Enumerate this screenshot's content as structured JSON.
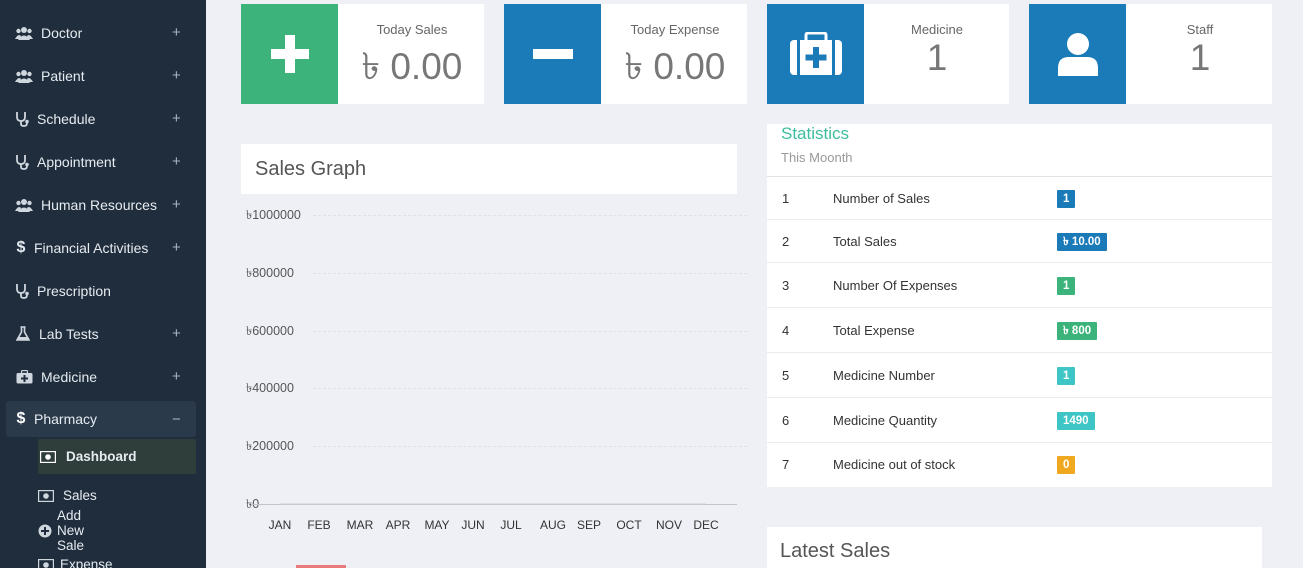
{
  "sidebar": {
    "items": [
      {
        "label": "Doctor",
        "icon": "users-icon",
        "expand": "+"
      },
      {
        "label": "Patient",
        "icon": "users-icon",
        "expand": "+"
      },
      {
        "label": "Schedule",
        "icon": "stethoscope-icon",
        "expand": "+"
      },
      {
        "label": "Appointment",
        "icon": "stethoscope-icon",
        "expand": "+"
      },
      {
        "label": "Human Resources",
        "icon": "users-icon",
        "expand": "+"
      },
      {
        "label": "Financial Activities",
        "icon": "dollar-icon",
        "expand": "+"
      },
      {
        "label": "Prescription",
        "icon": "stethoscope-icon",
        "expand": ""
      },
      {
        "label": "Lab Tests",
        "icon": "flask-icon",
        "expand": "+"
      },
      {
        "label": "Medicine",
        "icon": "medkit-icon",
        "expand": "+"
      },
      {
        "label": "Pharmacy",
        "icon": "dollar-icon",
        "expand": "−"
      }
    ],
    "pharmacy_sub": [
      {
        "label": "Dashboard",
        "icon": "money-icon"
      },
      {
        "label": "Sales",
        "icon": "money-icon"
      },
      {
        "label": "Add New Sale",
        "icon": "plus-circle-icon"
      },
      {
        "label": "Expense",
        "icon": "money-icon"
      }
    ]
  },
  "cards": [
    {
      "label": "Today Sales",
      "value": "৳ 0.00",
      "color": "#3cb37a",
      "icon": "plus-icon"
    },
    {
      "label": "Today Expense",
      "value": "৳ 0.00",
      "color": "#1b7ab8",
      "icon": "minus-icon"
    },
    {
      "label": "Medicine",
      "value": "1",
      "color": "#1b7ab8",
      "icon": "medkit-icon"
    },
    {
      "label": "Staff",
      "value": "1",
      "color": "#1b7ab8",
      "icon": "user-icon"
    }
  ],
  "sales_graph": {
    "title": "Sales Graph"
  },
  "chart_data": {
    "type": "line",
    "categories": [
      "JAN",
      "FEB",
      "MAR",
      "APR",
      "MAY",
      "JUN",
      "JUL",
      "AUG",
      "SEP",
      "OCT",
      "NOV",
      "DEC"
    ],
    "series": [
      {
        "values": [
          0,
          0,
          0,
          0,
          0,
          0,
          0,
          0,
          0,
          0,
          0,
          0
        ]
      }
    ],
    "yticks": [
      "৳0",
      "৳200000",
      "৳400000",
      "৳600000",
      "৳800000",
      "৳1000000"
    ],
    "ylim": [
      0,
      1000000
    ],
    "grid": true
  },
  "statistics": {
    "title": "Statistics",
    "subtitle": "This Moonth",
    "rows": [
      {
        "n": "1",
        "label": "Number of Sales",
        "badge": "1",
        "color": "#1b7ab8"
      },
      {
        "n": "2",
        "label": "Total Sales",
        "badge": "৳ 10.00",
        "color": "#1b7ab8"
      },
      {
        "n": "3",
        "label": "Number Of Expenses",
        "badge": "1",
        "color": "#3cb37a"
      },
      {
        "n": "4",
        "label": "Total Expense",
        "badge": "৳ 800",
        "color": "#3cb37a"
      },
      {
        "n": "5",
        "label": "Medicine Number",
        "badge": "1",
        "color": "#3ec5c5"
      },
      {
        "n": "6",
        "label": "Medicine Quantity",
        "badge": "1490",
        "color": "#3ec5c5"
      },
      {
        "n": "7",
        "label": "Medicine out of stock",
        "badge": "0",
        "color": "#f0a820"
      }
    ]
  },
  "latest_sales": {
    "title": "Latest Sales"
  }
}
